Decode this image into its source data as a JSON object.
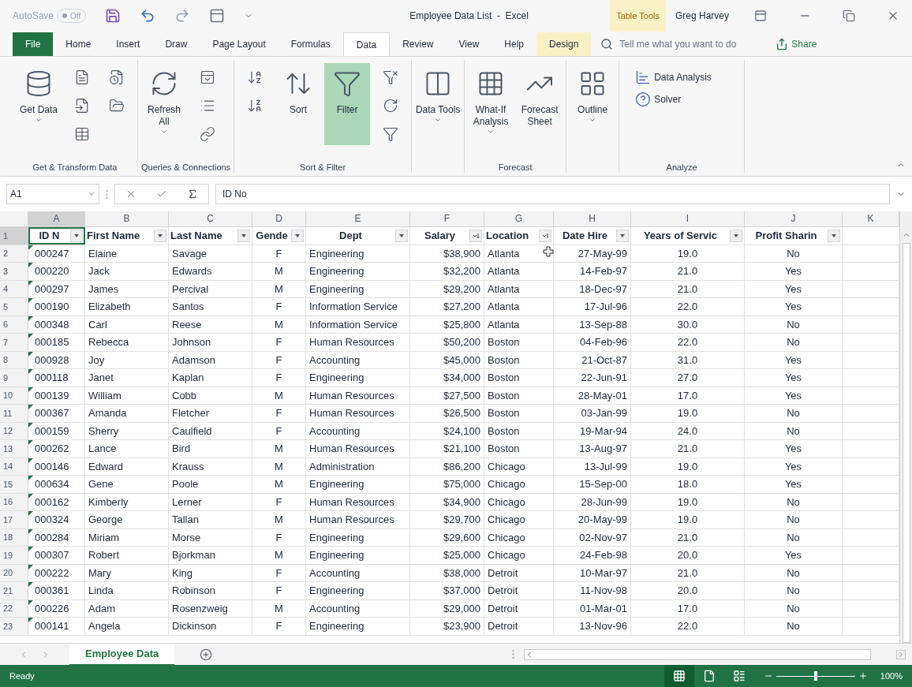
{
  "title_bar": {
    "autosave_label": "AutoSave",
    "autosave_toggle": {
      "text": "Off",
      "on": false
    },
    "title": "Employee Data List  -  Excel",
    "context_label": "Table Tools",
    "user": "Greg Harvey"
  },
  "tabs": [
    {
      "label": "File",
      "kind": "file",
      "selected": false
    },
    {
      "label": "Home",
      "kind": "normal",
      "selected": false
    },
    {
      "label": "Insert",
      "kind": "normal",
      "selected": false
    },
    {
      "label": "Draw",
      "kind": "normal",
      "selected": false
    },
    {
      "label": "Page Layout",
      "kind": "normal",
      "selected": false
    },
    {
      "label": "Formulas",
      "kind": "normal",
      "selected": false
    },
    {
      "label": "Data",
      "kind": "normal",
      "selected": true
    },
    {
      "label": "Review",
      "kind": "normal",
      "selected": false
    },
    {
      "label": "View",
      "kind": "normal",
      "selected": false
    },
    {
      "label": "Help",
      "kind": "normal",
      "selected": false
    },
    {
      "label": "Design",
      "kind": "context",
      "selected": false
    }
  ],
  "search": {
    "placeholder": "Tell me what you want to do"
  },
  "share": "Share",
  "ribbon": {
    "groups": [
      {
        "label": "Get & Transform Data",
        "buttons": [
          {
            "kind": "large",
            "label": "Get Data",
            "dropdown": true,
            "pressed": false
          },
          {
            "kind": "small"
          },
          {
            "kind": "small"
          },
          {
            "kind": "small"
          },
          {
            "kind": "small"
          },
          {
            "kind": "small"
          }
        ]
      },
      {
        "label": "Queries & Connections",
        "buttons": [
          {
            "kind": "large",
            "label": "Refresh All",
            "dropdown": true,
            "pressed": false
          },
          {
            "kind": "small"
          },
          {
            "kind": "small"
          },
          {
            "kind": "small"
          }
        ]
      },
      {
        "label": "Sort & Filter",
        "buttons": [
          {
            "kind": "small"
          },
          {
            "kind": "small"
          },
          {
            "kind": "large",
            "label": "Sort",
            "dropdown": false,
            "pressed": false
          },
          {
            "kind": "large",
            "label": "Filter",
            "dropdown": false,
            "pressed": true
          },
          {
            "kind": "small"
          },
          {
            "kind": "small"
          },
          {
            "kind": "small"
          }
        ]
      },
      {
        "buttons": [
          {
            "kind": "large",
            "label": "Data Tools",
            "dropdown": true,
            "pressed": false
          }
        ]
      },
      {
        "label": "Forecast",
        "buttons": [
          {
            "kind": "large",
            "label": "What-If Analysis",
            "dropdown": true,
            "pressed": false
          },
          {
            "kind": "large",
            "label": "Forecast Sheet",
            "dropdown": false,
            "pressed": false
          }
        ]
      },
      {
        "buttons": [
          {
            "kind": "large",
            "label": "Outline",
            "dropdown": true,
            "pressed": false
          }
        ]
      },
      {
        "label": "Analyze",
        "buttons": [
          {
            "kind": "row",
            "label": "Data Analysis"
          },
          {
            "kind": "row",
            "label": "Solver"
          }
        ]
      }
    ]
  },
  "formula_bar": {
    "name_box": "A1",
    "value": "ID No"
  },
  "column_letters": [
    "A",
    "B",
    "C",
    "D",
    "E",
    "F",
    "G",
    "H",
    "I",
    "J",
    "K"
  ],
  "header_row": {
    "number": "1",
    "cells": [
      {
        "text": "ID N",
        "sorted_ascending": false,
        "sorted_descending": false
      },
      {
        "text": "First Name",
        "sorted_ascending": false,
        "sorted_descending": false
      },
      {
        "text": "Last Name",
        "sorted_ascending": false,
        "sorted_descending": false
      },
      {
        "text": "Gende",
        "sorted_ascending": false,
        "sorted_descending": false
      },
      {
        "text": "Dept",
        "sorted_ascending": false,
        "sorted_descending": false
      },
      {
        "text": "Salary",
        "sorted_ascending": false,
        "sorted_descending": true
      },
      {
        "text": "Location",
        "sorted_ascending": true,
        "sorted_descending": false
      },
      {
        "text": "Date Hire",
        "sorted_ascending": false,
        "sorted_descending": false
      },
      {
        "text": "Years of Servic",
        "sorted_ascending": false,
        "sorted_descending": false
      },
      {
        "text": "Profit Sharin",
        "sorted_ascending": false,
        "sorted_descending": false
      }
    ]
  },
  "rows": [
    {
      "number": "2",
      "cells": [
        "000247",
        "Elaine",
        "Savage",
        "F",
        "Engineering",
        "$38,900",
        "Atlanta",
        "27-May-99",
        "19.0",
        "No"
      ]
    },
    {
      "number": "3",
      "cells": [
        "000220",
        "Jack",
        "Edwards",
        "M",
        "Engineering",
        "$32,200",
        "Atlanta",
        "14-Feb-97",
        "21.0",
        "Yes"
      ]
    },
    {
      "number": "4",
      "cells": [
        "000297",
        "James",
        "Percival",
        "M",
        "Engineering",
        "$29,200",
        "Atlanta",
        "18-Dec-97",
        "21.0",
        "Yes"
      ]
    },
    {
      "number": "5",
      "cells": [
        "000190",
        "Elizabeth",
        "Santos",
        "F",
        "Information Service",
        "$27,200",
        "Atlanta",
        "17-Jul-96",
        "22.0",
        "Yes"
      ]
    },
    {
      "number": "6",
      "cells": [
        "000348",
        "Carl",
        "Reese",
        "M",
        "Information Service",
        "$25,800",
        "Atlanta",
        "13-Sep-88",
        "30.0",
        "No"
      ]
    },
    {
      "number": "7",
      "cells": [
        "000185",
        "Rebecca",
        "Johnson",
        "F",
        "Human Resources",
        "$50,200",
        "Boston",
        "04-Feb-96",
        "22.0",
        "No"
      ]
    },
    {
      "number": "8",
      "cells": [
        "000928",
        "Joy",
        "Adamson",
        "F",
        "Accounting",
        "$45,000",
        "Boston",
        "21-Oct-87",
        "31.0",
        "Yes"
      ]
    },
    {
      "number": "9",
      "cells": [
        "000118",
        "Janet",
        "Kaplan",
        "F",
        "Engineering",
        "$34,000",
        "Boston",
        "22-Jun-91",
        "27.0",
        "Yes"
      ]
    },
    {
      "number": "10",
      "cells": [
        "000139",
        "William",
        "Cobb",
        "M",
        "Human Resources",
        "$27,500",
        "Boston",
        "28-May-01",
        "17.0",
        "Yes"
      ]
    },
    {
      "number": "11",
      "cells": [
        "000367",
        "Amanda",
        "Fletcher",
        "F",
        "Human Resources",
        "$26,500",
        "Boston",
        "03-Jan-99",
        "19.0",
        "No"
      ]
    },
    {
      "number": "12",
      "cells": [
        "000159",
        "Sherry",
        "Caulfield",
        "F",
        "Accounting",
        "$24,100",
        "Boston",
        "19-Mar-94",
        "24.0",
        "No"
      ]
    },
    {
      "number": "13",
      "cells": [
        "000262",
        "Lance",
        "Bird",
        "M",
        "Human Resources",
        "$21,100",
        "Boston",
        "13-Aug-97",
        "21.0",
        "Yes"
      ]
    },
    {
      "number": "14",
      "cells": [
        "000146",
        "Edward",
        "Krauss",
        "M",
        "Administration",
        "$86,200",
        "Chicago",
        "13-Jul-99",
        "19.0",
        "Yes"
      ]
    },
    {
      "number": "15",
      "cells": [
        "000634",
        "Gene",
        "Poole",
        "M",
        "Engineering",
        "$75,000",
        "Chicago",
        "15-Sep-00",
        "18.0",
        "Yes"
      ]
    },
    {
      "number": "16",
      "cells": [
        "000162",
        "Kimberly",
        "Lerner",
        "F",
        "Human Resources",
        "$34,900",
        "Chicago",
        "28-Jun-99",
        "19.0",
        "No"
      ]
    },
    {
      "number": "17",
      "cells": [
        "000324",
        "George",
        "Tallan",
        "M",
        "Human Resources",
        "$29,700",
        "Chicago",
        "20-May-99",
        "19.0",
        "No"
      ]
    },
    {
      "number": "18",
      "cells": [
        "000284",
        "Miriam",
        "Morse",
        "F",
        "Engineering",
        "$29,600",
        "Chicago",
        "02-Nov-97",
        "21.0",
        "No"
      ]
    },
    {
      "number": "19",
      "cells": [
        "000307",
        "Robert",
        "Bjorkman",
        "M",
        "Engineering",
        "$25,000",
        "Chicago",
        "24-Feb-98",
        "20.0",
        "Yes"
      ]
    },
    {
      "number": "20",
      "cells": [
        "000222",
        "Mary",
        "King",
        "F",
        "Accounting",
        "$38,000",
        "Detroit",
        "10-Mar-97",
        "21.0",
        "No"
      ]
    },
    {
      "number": "21",
      "cells": [
        "000361",
        "Linda",
        "Robinson",
        "F",
        "Engineering",
        "$37,000",
        "Detroit",
        "11-Nov-98",
        "20.0",
        "No"
      ]
    },
    {
      "number": "22",
      "cells": [
        "000226",
        "Adam",
        "Rosenzweig",
        "M",
        "Accounting",
        "$29,000",
        "Detroit",
        "01-Mar-01",
        "17.0",
        "No"
      ]
    },
    {
      "number": "23",
      "cells": [
        "000141",
        "Angela",
        "Dickinson",
        "F",
        "Engineering",
        "$23,900",
        "Detroit",
        "13-Nov-96",
        "22.0",
        "No"
      ]
    }
  ],
  "sheet_tabs": [
    {
      "label": "Employee Data",
      "selected": true
    }
  ],
  "status_bar": {
    "status": "Ready",
    "views": [
      {
        "kind": "normal",
        "selected": true
      },
      {
        "kind": "page_layout",
        "selected": false
      },
      {
        "kind": "page_break",
        "selected": false
      }
    ],
    "zoom": {
      "level": 0.5,
      "text": "100%"
    }
  }
}
